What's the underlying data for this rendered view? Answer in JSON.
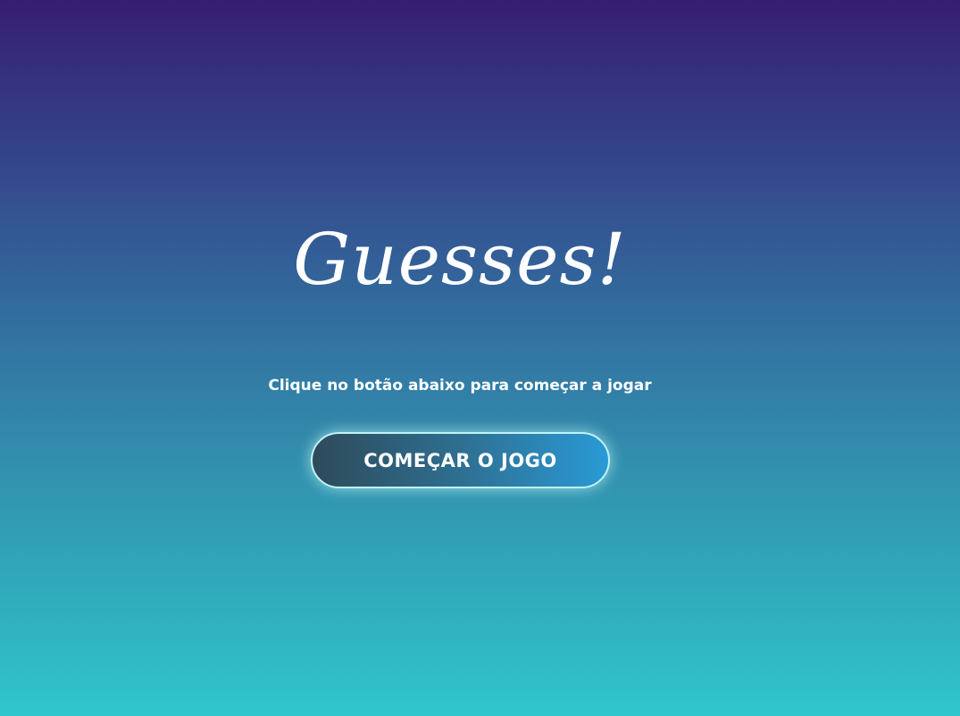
{
  "page": {
    "title": "Guesses!",
    "subtitle": "Clique no botão abaixo para começar a jogar",
    "start_button_label": "COMEÇAR O JOGO"
  },
  "colors": {
    "background_top": "#361e73",
    "background_bottom": "#30c6ce",
    "button_left": "#2e4a5a",
    "button_right": "#2a9ad6",
    "button_border": "#bff4f4",
    "text": "#ffffff"
  }
}
